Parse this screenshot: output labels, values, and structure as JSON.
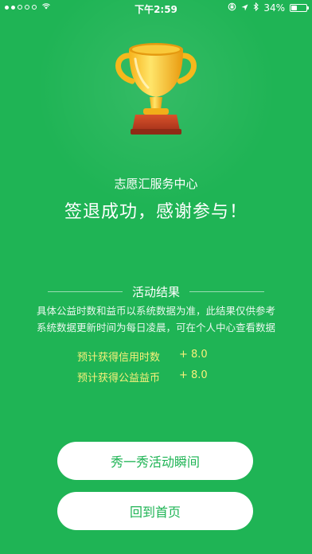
{
  "status_bar": {
    "carrier_signal": "●●○○○",
    "time": "下午2:59",
    "battery_percent": "34%"
  },
  "header": {
    "organization": "志愿汇服务中心",
    "message": "签退成功，感谢参与！"
  },
  "result": {
    "title": "活动结果",
    "description_line1": "具体公益时数和益币以系统数据为准，此结果仅供参考",
    "description_line2": "系统数据更新时间为每日凌晨，可在个人中心查看数据",
    "items": [
      {
        "label": "预计获得信用时数",
        "value": "+ 8.0"
      },
      {
        "label": "预计获得公益益币",
        "value": "+ 8.0"
      }
    ]
  },
  "actions": {
    "share_label": "秀一秀活动瞬间",
    "home_label": "回到首页"
  },
  "colors": {
    "background": "#1fb455",
    "highlight_text": "#f6f07a",
    "button_background": "#ffffff"
  },
  "icons": {
    "trophy": "trophy-icon",
    "wifi": "wifi-icon",
    "location": "location-arrow-icon",
    "bluetooth": "bluetooth-icon",
    "lock_rotation": "orientation-lock-icon",
    "battery": "battery-icon"
  }
}
